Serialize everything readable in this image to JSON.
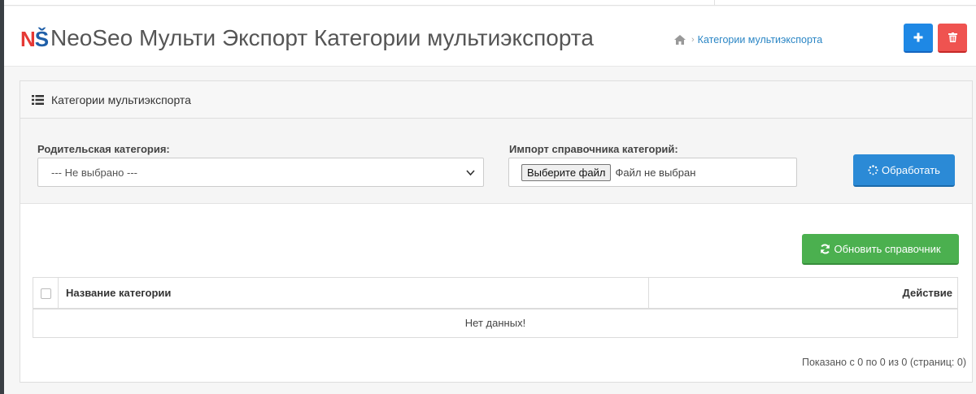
{
  "header": {
    "logo_n": "N",
    "logo_s": "Š",
    "title": "NeoSeo Мульти Экспорт Категории мультиэкспорта",
    "breadcrumb": {
      "current": "Категории мультиэкспорта"
    },
    "buttons": {
      "add_icon": "plus-icon",
      "delete_icon": "trash-icon"
    },
    "colors": {
      "add": "#1e88e5",
      "delete": "#ef5350"
    }
  },
  "panel": {
    "heading": "Категории мультиэкспорта",
    "filter": {
      "parent_label": "Родительская категория:",
      "parent_selected": "--- Не выбрано ---",
      "import_label": "Импорт справочника категорий:",
      "file_button": "Выберите файл",
      "file_status": "Файл не выбран",
      "process_button": "Обработать"
    },
    "refresh_button": "Обновить справочник",
    "table": {
      "columns": [
        "Название категории",
        "Действие"
      ],
      "empty_text": "Нет данных!"
    },
    "pagination": "Показано с 0 по 0 из 0 (страниц: 0)"
  }
}
